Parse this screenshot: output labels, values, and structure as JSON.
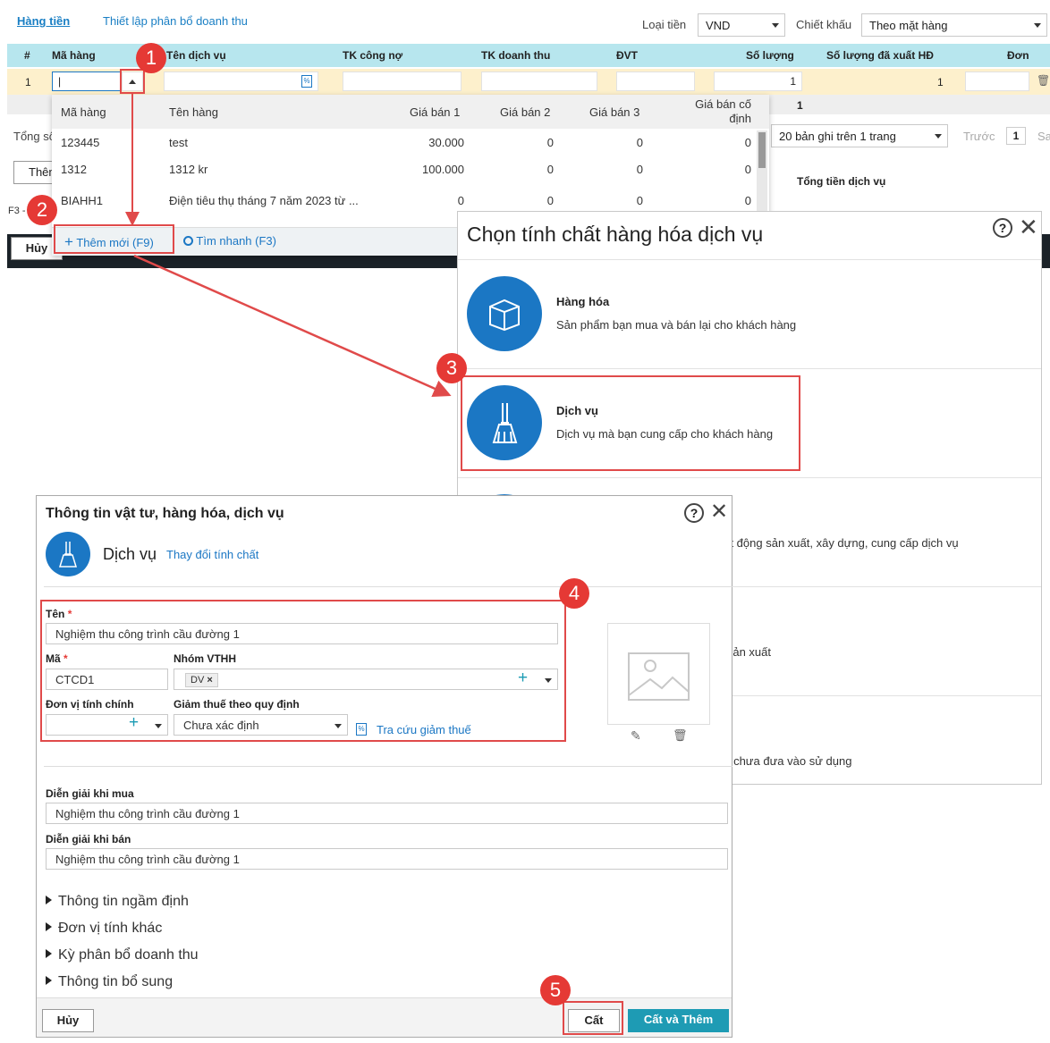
{
  "top": {
    "tab_active": "Hàng tiền",
    "tab_other": "Thiết lập phân bổ doanh thu",
    "currency_label": "Loại tiền",
    "currency_value": "VND",
    "discount_label": "Chiết khấu",
    "discount_value": "Theo mặt hàng",
    "columns": [
      "#",
      "Mã hàng",
      "Tên dịch vụ",
      "TK công nợ",
      "TK doanh thu",
      "ĐVT",
      "Số lượng",
      "Số lượng đã xuất HĐ",
      "Đơn"
    ],
    "row": {
      "index": "1",
      "qty": "1",
      "qty_out": "1"
    },
    "total_qty": "1",
    "total_label": "Tổng số",
    "page_size": "20 bản ghi trên 1 trang",
    "prev": "Trước",
    "page": "1",
    "next": "Sa",
    "add_row": "Thêm",
    "f3": "F3 -",
    "cancel": "Hủy",
    "total_service": "Tổng tiền dịch vụ"
  },
  "dropdown": {
    "headers": [
      "Mã hàng",
      "Tên hàng",
      "Giá bán 1",
      "Giá bán 2",
      "Giá bán 3",
      "Giá bán cố định"
    ],
    "rows": [
      [
        "123445",
        "test",
        "30.000",
        "0",
        "0",
        "0"
      ],
      [
        "1312",
        "1312 kr",
        "100.000",
        "0",
        "0",
        "0"
      ],
      [
        "BIAHH1",
        "Điện tiêu thụ tháng 7 năm 2023 từ ...",
        "0",
        "0",
        "0",
        "0"
      ]
    ],
    "add_new": "Thêm mới (F9)",
    "quick_find": "Tìm nhanh (F3)"
  },
  "dialog_type": {
    "title": "Chọn tính chất hàng hóa dịch vụ",
    "options": [
      {
        "title": "Hàng hóa",
        "desc": "Sản phẩm bạn mua và bán lại cho khách hàng"
      },
      {
        "title": "Dịch vụ",
        "desc": "Dịch vụ mà bạn cung cấp cho khách hàng"
      },
      {
        "title": "",
        "desc": "oạt động sản xuất, xây dựng, cung cấp dịch vụ"
      },
      {
        "title": "",
        "desc": "h sản xuất"
      },
      {
        "title": "",
        "desc": "ho chưa đưa vào sử dụng"
      }
    ]
  },
  "dialog_info": {
    "title": "Thông tin vật tư, hàng hóa, dịch vụ",
    "type": "Dịch vụ",
    "change": "Thay đổi tính chất",
    "name_label": "Tên",
    "name_value": "Nghiệm thu công trình cầu đường 1",
    "code_label": "Mã",
    "code_value": "CTCD1",
    "group_label": "Nhóm VTHH",
    "group_tag": "DV",
    "unit_label": "Đơn vị tính chính",
    "tax_label": "Giảm thuế theo quy định",
    "tax_value": "Chưa xác định",
    "tax_lookup": "Tra cứu giảm thuế",
    "buy_label": "Diễn giải khi mua",
    "buy_value": "Nghiệm thu công trình cầu đường 1",
    "sell_label": "Diễn giải khi bán",
    "sell_value": "Nghiệm thu công trình cầu đường 1",
    "sections": [
      "Thông tin ngầm định",
      "Đơn vị tính khác",
      "Kỳ phân bổ doanh thu",
      "Thông tin bổ sung"
    ],
    "cancel": "Hủy",
    "save": "Cất",
    "save_add": "Cất và Thêm"
  },
  "steps": [
    "1",
    "2",
    "3",
    "4",
    "5"
  ],
  "colors": {
    "accent": "#1b77c4",
    "header_teal": "#b7e6ee",
    "highlight": "#e53935",
    "save_add": "#1e9bb4"
  }
}
